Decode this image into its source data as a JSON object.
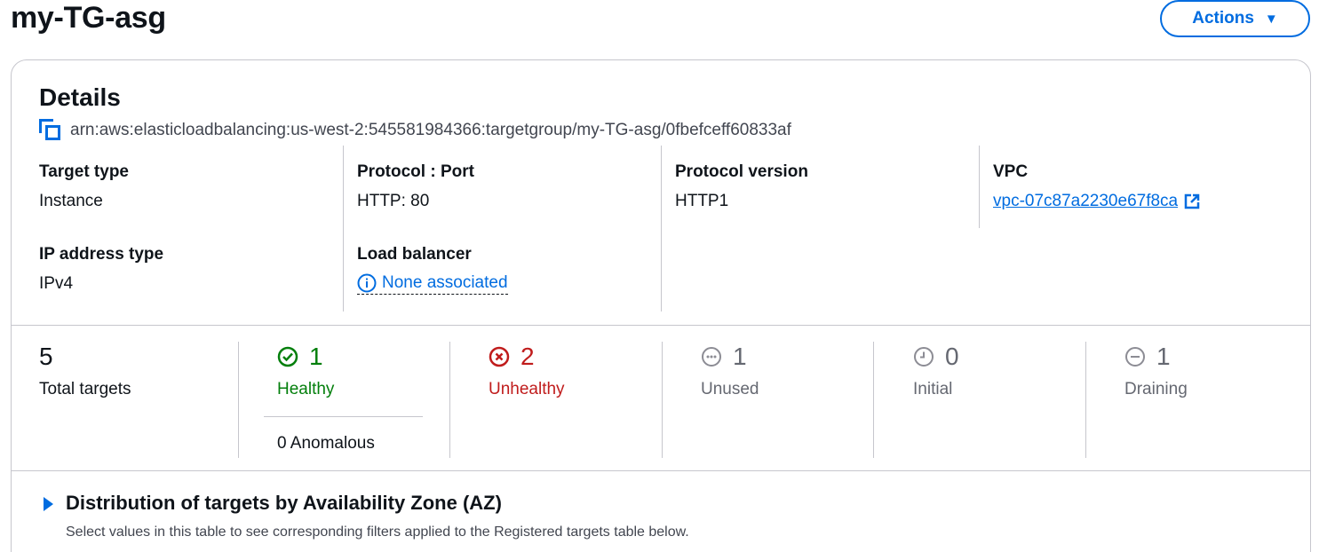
{
  "page": {
    "title": "my-TG-asg"
  },
  "actions": {
    "label": "Actions",
    "caret": "▼"
  },
  "details": {
    "title": "Details",
    "arn": "arn:aws:elasticloadbalancing:us-west-2:545581984366:targetgroup/my-TG-asg/0fbefceff60833af",
    "target_type": {
      "label": "Target type",
      "value": "Instance"
    },
    "protocol_port": {
      "label": "Protocol : Port",
      "value": "HTTP: 80"
    },
    "protocol_version": {
      "label": "Protocol version",
      "value": "HTTP1"
    },
    "vpc": {
      "label": "VPC",
      "value": "vpc-07c87a2230e67f8ca"
    },
    "ip_address_type": {
      "label": "IP address type",
      "value": "IPv4"
    },
    "load_balancer": {
      "label": "Load balancer",
      "value": "None associated"
    }
  },
  "stats": {
    "total": {
      "count": "5",
      "label": "Total targets"
    },
    "healthy": {
      "count": "1",
      "label": "Healthy",
      "anomalous": "0 Anomalous",
      "color": "#037f0c"
    },
    "unhealthy": {
      "count": "2",
      "label": "Unhealthy",
      "color": "#c01c1c"
    },
    "unused": {
      "count": "1",
      "label": "Unused"
    },
    "initial": {
      "count": "0",
      "label": "Initial"
    },
    "draining": {
      "count": "1",
      "label": "Draining"
    },
    "muted_color": "#656871"
  },
  "distribution": {
    "title": "Distribution of targets by Availability Zone (AZ)",
    "description": "Select values in this table to see corresponding filters applied to the Registered targets table below."
  },
  "colors": {
    "accent": "#006ce0",
    "border": "#c6c6cd"
  }
}
